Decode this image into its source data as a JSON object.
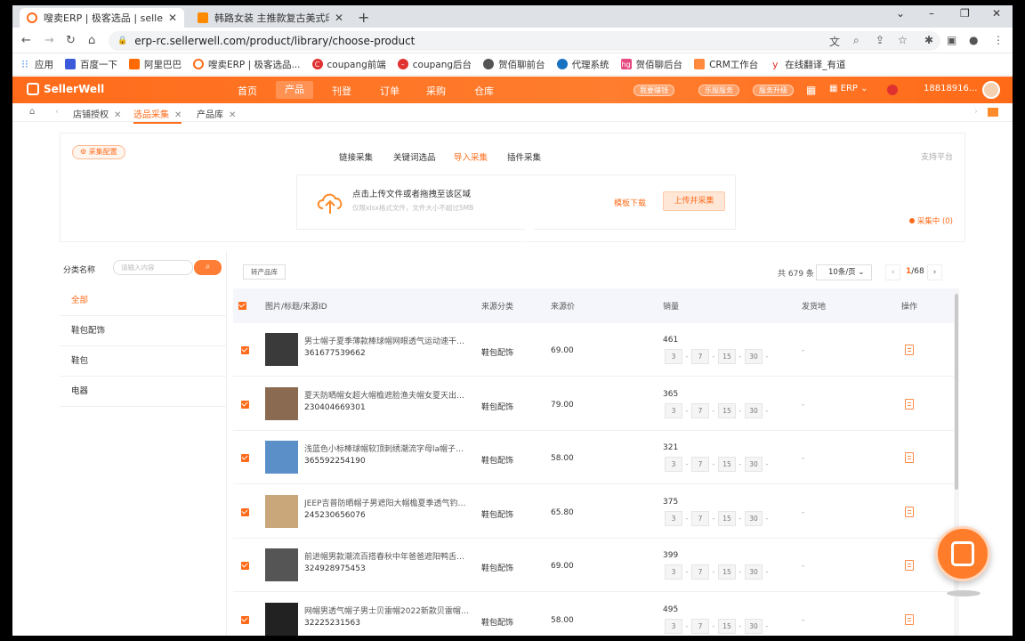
{
  "browser": {
    "tabs": [
      {
        "title": "嗖卖ERP | 极客选品 | sellerwell",
        "active": true,
        "fav": "#ff6b1a"
      },
      {
        "title": "韩路女装 主推款复古美式印花T恤",
        "active": false,
        "fav": "#ff8a00"
      }
    ],
    "url": "erp-rc.sellerwell.com/product/library/choose-product",
    "bookmarks": [
      "应用",
      "百度一下",
      "阿里巴巴",
      "嗖卖ERP | 极客选品...",
      "coupang前端",
      "coupang后台",
      "贺佰聊前台",
      "代理系统",
      "贺佰聊后台",
      "CRM工作台",
      "在线翻译_有道"
    ]
  },
  "header": {
    "logo": "SellerWell",
    "nav": [
      "首页",
      "产品",
      "刊登",
      "订单",
      "采购",
      "仓库"
    ],
    "active_nav": "产品",
    "pills": [
      "我要赚钱",
      "乐服服务",
      "服务升级"
    ],
    "erp": "ERP",
    "user": "18818916..."
  },
  "crumbs": [
    {
      "label": "店铺授权",
      "active": false
    },
    {
      "label": "选品采集",
      "active": true
    },
    {
      "label": "产品库",
      "active": false
    }
  ],
  "collect": {
    "config_label": "采集配置",
    "tabs": [
      "链接采集",
      "关键词选品",
      "导入采集",
      "插件采集"
    ],
    "active_tab": "导入采集",
    "support": "支持平台",
    "upload_title": "点击上传文件或者拖拽至该区域",
    "upload_sub": "仅限xlsx格式文件，文件大小不超过5MB",
    "template": "模板下载",
    "upload_btn": "上传并采集",
    "status": "采集中 (0)"
  },
  "sidebar": {
    "label": "分类名称",
    "placeholder": "请输入内容",
    "items": [
      "全部",
      "鞋包配饰",
      "鞋包",
      "电器"
    ]
  },
  "toolbar": {
    "move_btn": "转产品库",
    "total": "共 679 条",
    "per_page": "10条/页",
    "page_current": "1",
    "page_total": "/68"
  },
  "table": {
    "columns": [
      "图片/标题/来源ID",
      "来源分类",
      "来源价",
      "销量",
      "发货地",
      "操作"
    ],
    "rows": [
      {
        "title": "男士帽子夏季薄款棒球帽网眼透气运动速干帽...",
        "id": "361677539662",
        "category": "鞋包配饰",
        "price": "69.00",
        "sales": "461",
        "ship": "-"
      },
      {
        "title": "夏天防晒帽女超大帽檐遮脸渔夫帽女夏天出游...",
        "id": "230404669301",
        "category": "鞋包配饰",
        "price": "79.00",
        "sales": "365",
        "ship": "-"
      },
      {
        "title": "浅蓝色小标棒球帽软顶刺绣潮流字母la帽子显...",
        "id": "365592254190",
        "category": "鞋包配饰",
        "price": "58.00",
        "sales": "321",
        "ship": "-"
      },
      {
        "title": "JEEP吉普防晒帽子男遮阳大帽檐夏季透气钓鱼...",
        "id": "245230656076",
        "category": "鞋包配饰",
        "price": "65.80",
        "sales": "375",
        "ship": "-"
      },
      {
        "title": "前进帽男款潮流百搭春秋中年爸爸遮阳鸭舌帽...",
        "id": "324928975453",
        "category": "鞋包配饰",
        "price": "69.00",
        "sales": "399",
        "ship": "-"
      },
      {
        "title": "网帽男透气帽子男士贝雷帽2022新款贝雷帽女...",
        "id": "32225231563",
        "category": "鞋包配饰",
        "price": "58.00",
        "sales": "495",
        "ship": "-"
      }
    ],
    "sales_days": [
      "3",
      "7",
      "15",
      "30"
    ]
  }
}
